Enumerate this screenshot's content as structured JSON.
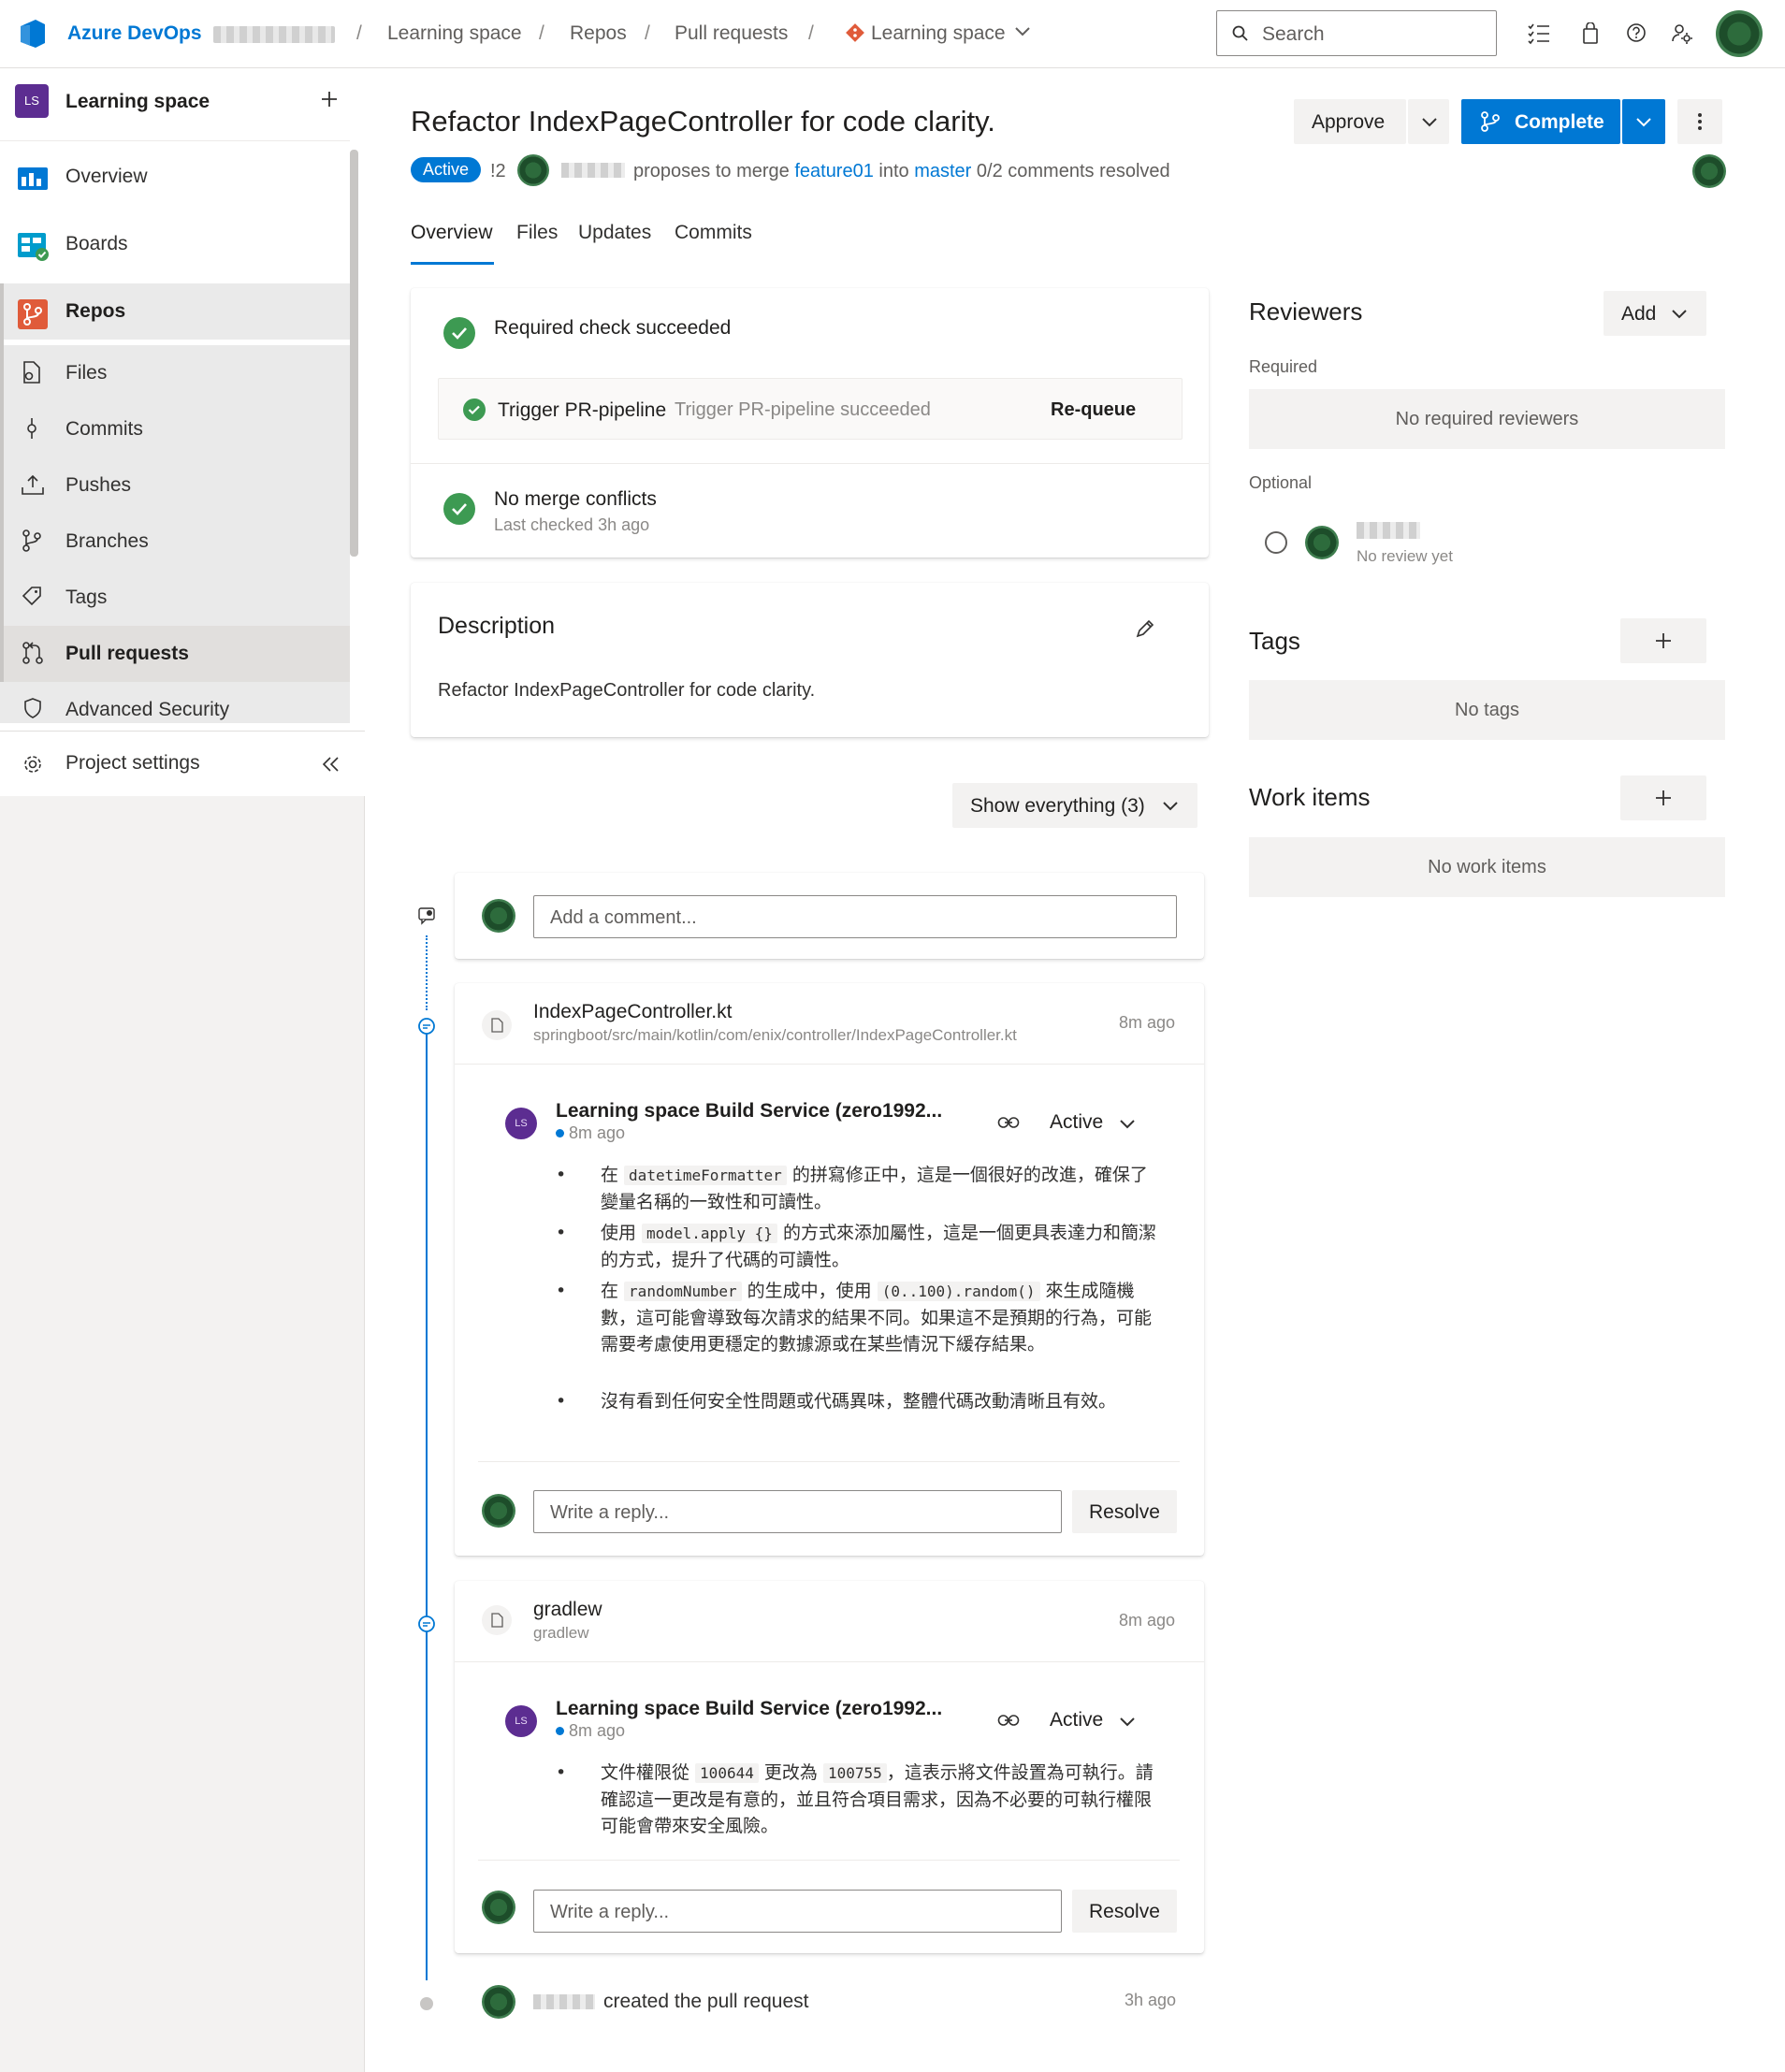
{
  "topbar": {
    "brand": "Azure DevOps",
    "breadcrumbs": [
      "Learning space",
      "Repos",
      "Pull requests",
      "Learning space"
    ],
    "search_placeholder": "Search"
  },
  "nav": {
    "project_badge": "LS",
    "project_name": "Learning space",
    "items": [
      {
        "label": "Overview"
      },
      {
        "label": "Boards"
      },
      {
        "label": "Repos"
      },
      {
        "label": "Files"
      },
      {
        "label": "Commits"
      },
      {
        "label": "Pushes"
      },
      {
        "label": "Branches"
      },
      {
        "label": "Tags"
      },
      {
        "label": "Pull requests"
      },
      {
        "label": "Advanced Security"
      }
    ],
    "settings_label": "Project settings"
  },
  "pr": {
    "title": "Refactor IndexPageController for code clarity.",
    "status": "Active",
    "id": "!2",
    "proposes_text": "proposes to merge",
    "source_branch": "feature01",
    "into_text": "into",
    "target_branch": "master",
    "comments_resolved": "0/2 comments resolved",
    "approve_label": "Approve",
    "complete_label": "Complete",
    "tabs": [
      "Overview",
      "Files",
      "Updates",
      "Commits"
    ]
  },
  "checks": {
    "required_check": "Required check succeeded",
    "pipeline_name": "Trigger PR-pipeline",
    "pipeline_status": "Trigger PR-pipeline succeeded",
    "requeue_label": "Re-queue",
    "merge_title": "No merge conflicts",
    "merge_sub": "Last checked 3h ago"
  },
  "description": {
    "heading": "Description",
    "body": "Refactor IndexPageController for code clarity."
  },
  "filter": {
    "label": "Show everything (3)"
  },
  "add_comment": {
    "placeholder": "Add a comment..."
  },
  "threads": [
    {
      "file_name": "IndexPageController.kt",
      "file_path": "springboot/src/main/kotlin/com/enix/controller/IndexPageController.kt",
      "time": "8m ago",
      "author_badge": "LS",
      "author": "Learning space Build Service (zero1992...",
      "comment_time": "8m ago",
      "status": "Active",
      "bullets": [
        {
          "pre": "在 ",
          "code": "datetimeFormatter",
          "post": " 的拼寫修正中，這是一個很好的改進，確保了變量名稱的一致性和可讀性。"
        },
        {
          "pre": "使用 ",
          "code": "model.apply {}",
          "post": " 的方式來添加屬性，這是一個更具表達力和簡潔的方式，提升了代碼的可讀性。"
        },
        {
          "pre": "在 ",
          "code": "randomNumber",
          "mid": " 的生成中，使用 ",
          "code2": "(0..100).random()",
          "post": " 來生成隨機數，這可能會導致每次請求的結果不同。如果這不是預期的行為，可能需要考慮使用更穩定的數據源或在某些情況下緩存結果。"
        },
        {
          "pre": "沒有看到任何安全性問題或代碼異味，整體代碼改動清晰且有效。"
        }
      ],
      "reply_placeholder": "Write a reply...",
      "resolve_label": "Resolve"
    },
    {
      "file_name": "gradlew",
      "file_path": "gradlew",
      "time": "8m ago",
      "author_badge": "LS",
      "author": "Learning space Build Service (zero1992...",
      "comment_time": "8m ago",
      "status": "Active",
      "bullets": [
        {
          "pre": "文件權限從 ",
          "code": "100644",
          "mid": " 更改為 ",
          "code2": "100755",
          "post": "，這表示將文件設置為可執行。請確認這一更改是有意的，並且符合項目需求，因為不必要的可執行權限可能會帶來安全風險。"
        }
      ],
      "reply_placeholder": "Write a reply...",
      "resolve_label": "Resolve"
    }
  ],
  "created": {
    "text": "created the pull request",
    "time": "3h ago"
  },
  "sidebar": {
    "reviewers_heading": "Reviewers",
    "add_label": "Add",
    "required_label": "Required",
    "no_required": "No required reviewers",
    "optional_label": "Optional",
    "reviewer_status": "No review yet",
    "tags_heading": "Tags",
    "no_tags": "No tags",
    "work_items_heading": "Work items",
    "no_work_items": "No work items"
  },
  "colors": {
    "accent": "#0078d4",
    "success": "#3d9a52",
    "repos_icon": "#e05b3a",
    "project_badge": "#5c2d91"
  }
}
